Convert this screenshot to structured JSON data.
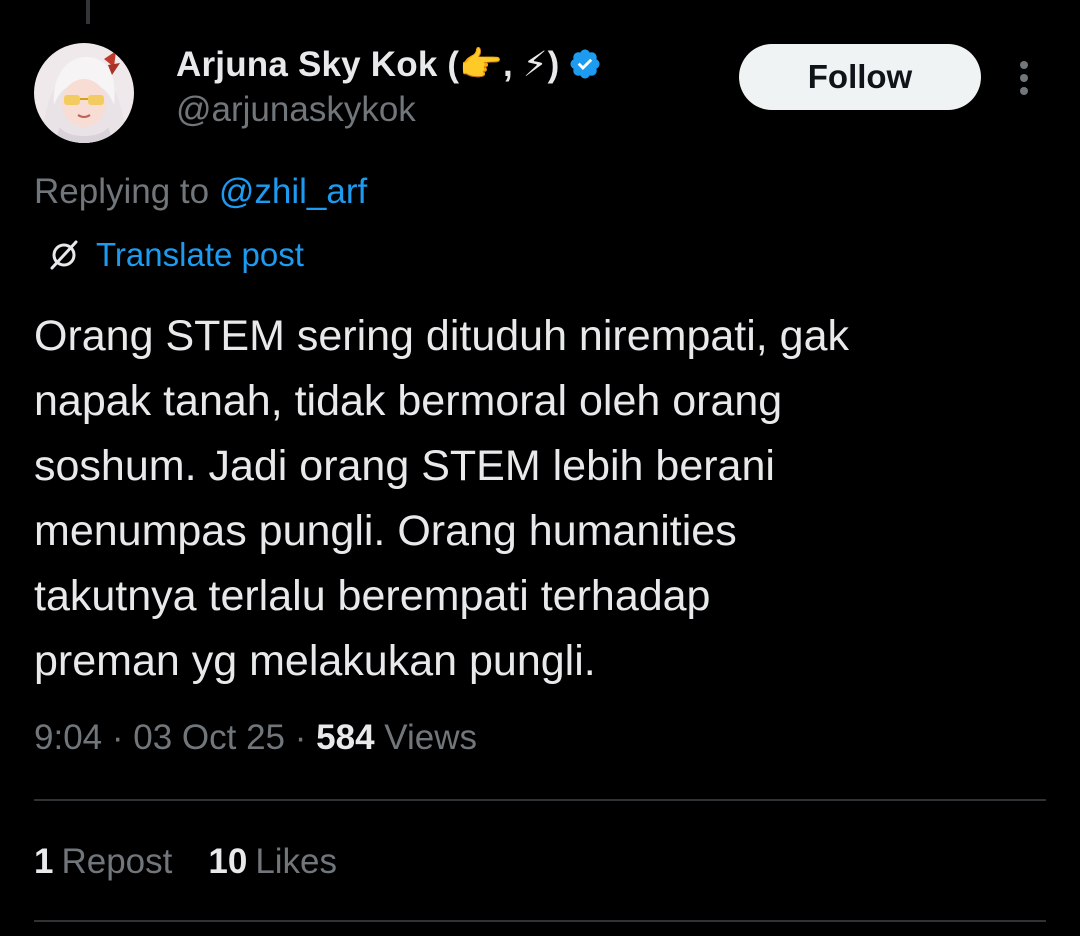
{
  "author": {
    "display_name": "Arjuna Sky Kok (👉, ⚡)",
    "handle": "@arjunaskykok",
    "verified": true,
    "avatar_icon": "anime-avatar"
  },
  "follow_button": {
    "label": "Follow"
  },
  "more_menu": {
    "icon": "more-vertical-icon"
  },
  "reply_context": {
    "prefix": "Replying to",
    "mention": "@zhil_arf"
  },
  "translate": {
    "icon": "globe-icon",
    "label": "Translate post"
  },
  "post": {
    "lines": [
      "Orang STEM sering dituduh nirempati, gak",
      "napak tanah, tidak bermoral oleh orang",
      "soshum. Jadi orang STEM lebih berani",
      "menumpas pungli. Orang humanities",
      "takutnya terlalu berempati terhadap",
      "preman yg melakukan pungli."
    ]
  },
  "meta": {
    "time": "9:04",
    "separator": "·",
    "date": "03 Oct 25",
    "views_count": "584",
    "views_label": "Views"
  },
  "stats": {
    "reposts_count": "1",
    "reposts_label": "Repost",
    "likes_count": "10",
    "likes_label": "Likes"
  },
  "colors": {
    "background": "#000000",
    "text": "#e7e9ea",
    "muted": "#71767b",
    "accent": "#1d9bf0",
    "divider": "#2f3336"
  }
}
